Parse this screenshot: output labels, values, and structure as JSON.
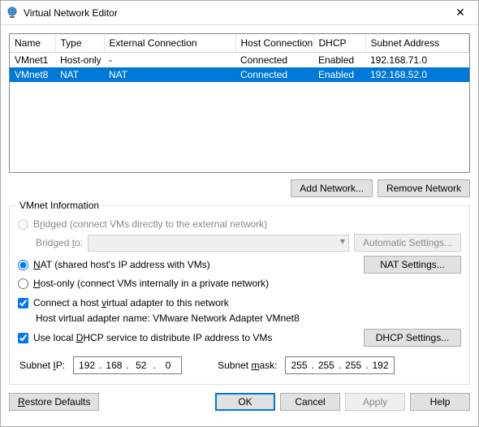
{
  "window": {
    "title": "Virtual Network Editor",
    "close_label": "✕"
  },
  "table": {
    "headers": {
      "name": "Name",
      "type": "Type",
      "external": "External Connection",
      "host": "Host Connection",
      "dhcp": "DHCP",
      "subnet": "Subnet Address"
    },
    "rows": [
      {
        "name": "VMnet1",
        "type": "Host-only",
        "external": "-",
        "host": "Connected",
        "dhcp": "Enabled",
        "subnet": "192.168.71.0",
        "selected": false
      },
      {
        "name": "VMnet8",
        "type": "NAT",
        "external": "NAT",
        "host": "Connected",
        "dhcp": "Enabled",
        "subnet": "192.168.52.0",
        "selected": true
      }
    ]
  },
  "buttons": {
    "add_network": "Add Network...",
    "remove_network": "Remove Network",
    "automatic_settings": "Automatic Settings...",
    "nat_settings": "NAT Settings...",
    "dhcp_settings": "DHCP Settings...",
    "restore_defaults": "Restore Defaults",
    "ok": "OK",
    "cancel": "Cancel",
    "apply": "Apply",
    "help": "Help"
  },
  "group": {
    "legend": "VMnet Information",
    "bridged_pre": "B",
    "bridged_letter": "r",
    "bridged_post": "idged (connect VMs directly to the external network)",
    "bridged_to_pre": "Bridged ",
    "bridged_to_letter": "t",
    "bridged_to_post": "o:",
    "nat_letter": "N",
    "nat_post": "AT (shared host's IP address with VMs)",
    "hostonly_letter": "H",
    "hostonly_post": "ost-only (connect VMs internally in a private network)",
    "connect_host_pre": "Connect a host ",
    "connect_host_letter": "v",
    "connect_host_post": "irtual adapter to this network",
    "host_adapter_line": "Host virtual adapter name: VMware Network Adapter VMnet8",
    "use_dhcp_pre": "Use local ",
    "use_dhcp_letter": "D",
    "use_dhcp_post": "HCP service to distribute IP address to VMs",
    "subnet_ip_pre": "Subnet ",
    "subnet_ip_letter": "I",
    "subnet_ip_post": "P:",
    "subnet_mask_pre": "Subnet ",
    "subnet_mask_letter": "m",
    "subnet_mask_post": "ask:"
  },
  "radio": {
    "bridged": false,
    "nat": true,
    "hostonly": false
  },
  "check": {
    "connect_host": true,
    "use_dhcp": true
  },
  "subnet_ip": {
    "o1": "192",
    "o2": "168",
    "o3": "52",
    "o4": "0"
  },
  "subnet_mask": {
    "o1": "255",
    "o2": "255",
    "o3": "255",
    "o4": "192"
  },
  "restore_letter": "R",
  "restore_post": "estore Defaults"
}
